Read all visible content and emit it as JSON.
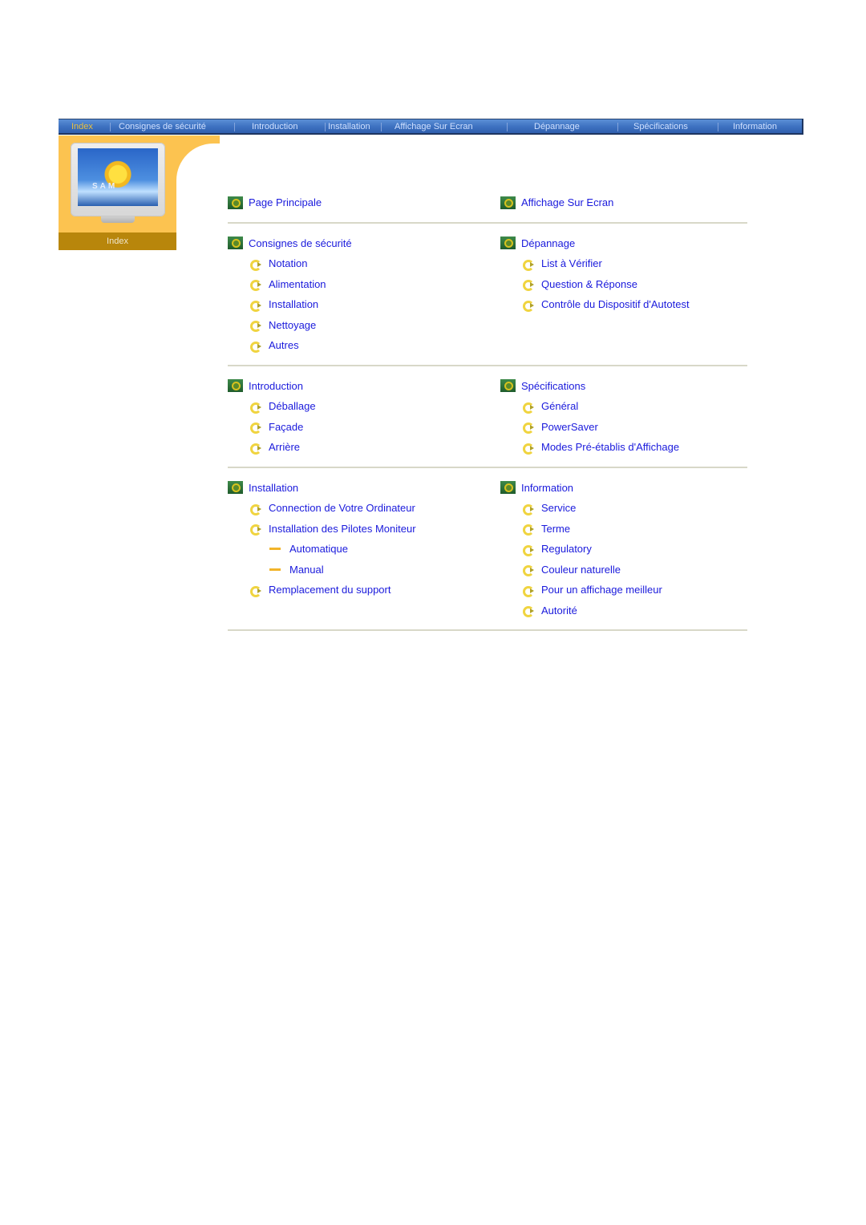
{
  "navbar": {
    "items": [
      {
        "label": "Index",
        "active": true
      },
      {
        "label": "Consignes de sécurité",
        "active": false
      },
      {
        "label": "Introduction",
        "active": false
      },
      {
        "label": "Installation",
        "active": false
      },
      {
        "label": "Affichage Sur Ecran",
        "active": false
      },
      {
        "label": "Dépannage",
        "active": false
      },
      {
        "label": "Spécifications",
        "active": false
      },
      {
        "label": "Information",
        "active": false
      }
    ],
    "colors": {
      "bar": "#3f73c2",
      "active_text": "#e8c040",
      "text": "#cfe0ff"
    }
  },
  "left_panel": {
    "monitor_logo": "SAM",
    "label": "Index",
    "colors": {
      "panel": "#fcc350",
      "label_bg": "#b8860b"
    }
  },
  "content": {
    "link_color": "#1a1adc",
    "sections": [
      {
        "left": [
          {
            "label": "Page Principale",
            "level": 1
          }
        ],
        "right": [
          {
            "label": "Affichage Sur Ecran",
            "level": 1
          }
        ]
      },
      {
        "left": [
          {
            "label": "Consignes de sécurité",
            "level": 1
          },
          {
            "label": "Notation",
            "level": 2
          },
          {
            "label": "Alimentation",
            "level": 2
          },
          {
            "label": "Installation",
            "level": 2
          },
          {
            "label": "Nettoyage",
            "level": 2
          },
          {
            "label": "Autres",
            "level": 2
          }
        ],
        "right": [
          {
            "label": "Dépannage",
            "level": 1
          },
          {
            "label": "List à Vérifier",
            "level": 2
          },
          {
            "label": "Question & Réponse",
            "level": 2
          },
          {
            "label": "Contrôle du Dispositif d'Autotest",
            "level": 2
          }
        ]
      },
      {
        "left": [
          {
            "label": "Introduction",
            "level": 1
          },
          {
            "label": "Déballage",
            "level": 2
          },
          {
            "label": "Façade",
            "level": 2
          },
          {
            "label": "Arrière",
            "level": 2
          }
        ],
        "right": [
          {
            "label": "Spécifications",
            "level": 1
          },
          {
            "label": "Général",
            "level": 2
          },
          {
            "label": "PowerSaver",
            "level": 2
          },
          {
            "label": "Modes Pré-établis d'Affichage",
            "level": 2
          }
        ]
      },
      {
        "left": [
          {
            "label": "Installation",
            "level": 1
          },
          {
            "label": "Connection de Votre Ordinateur",
            "level": 2
          },
          {
            "label": "Installation des Pilotes Moniteur",
            "level": 2
          },
          {
            "label": "Automatique",
            "level": 3
          },
          {
            "label": "Manual",
            "level": 3
          },
          {
            "label": "Remplacement du support",
            "level": 2
          }
        ],
        "right": [
          {
            "label": "Information",
            "level": 1
          },
          {
            "label": "Service",
            "level": 2
          },
          {
            "label": "Terme",
            "level": 2
          },
          {
            "label": "Regulatory",
            "level": 2
          },
          {
            "label": "Couleur naturelle",
            "level": 2
          },
          {
            "label": "Pour un affichage meilleur",
            "level": 2
          },
          {
            "label": "Autorité",
            "level": 2
          }
        ]
      }
    ]
  }
}
